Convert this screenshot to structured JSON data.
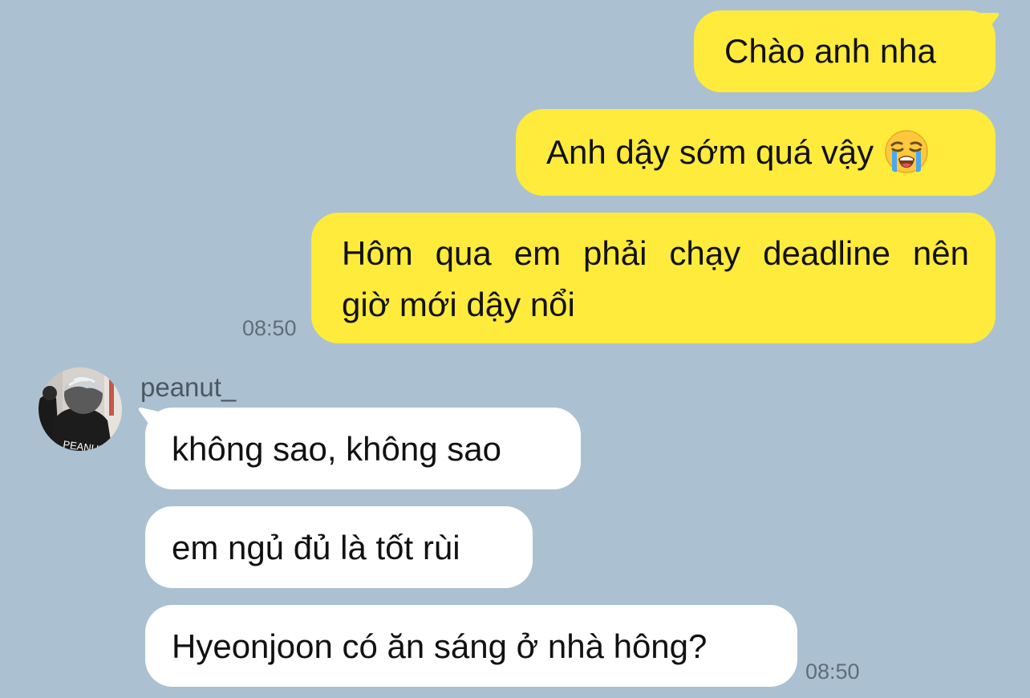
{
  "chat": {
    "outgoing": [
      {
        "text": "Chào anh nha"
      },
      {
        "text": "Anh dậy sớm quá vậy"
      },
      {
        "line1": "Hôm qua em phải chạy deadline nên",
        "line2": "giờ mới dậy nổi"
      }
    ],
    "outgoing_time": "08:50",
    "sender_name": "peanut_",
    "avatar_shirt_text": "PEANUT",
    "incoming": [
      {
        "text": "không sao, không sao"
      },
      {
        "text": "em ngủ đủ là tốt rùi"
      },
      {
        "text": "Hyeonjoon có ăn sáng ở nhà hông?"
      }
    ],
    "incoming_time": "08:50",
    "emoji_icon": "loudly-crying-face-icon"
  },
  "colors": {
    "background": "#abc1d1",
    "outgoing_bubble": "#ffeb3b",
    "incoming_bubble": "#ffffff",
    "timestamp": "#5f6d78"
  }
}
